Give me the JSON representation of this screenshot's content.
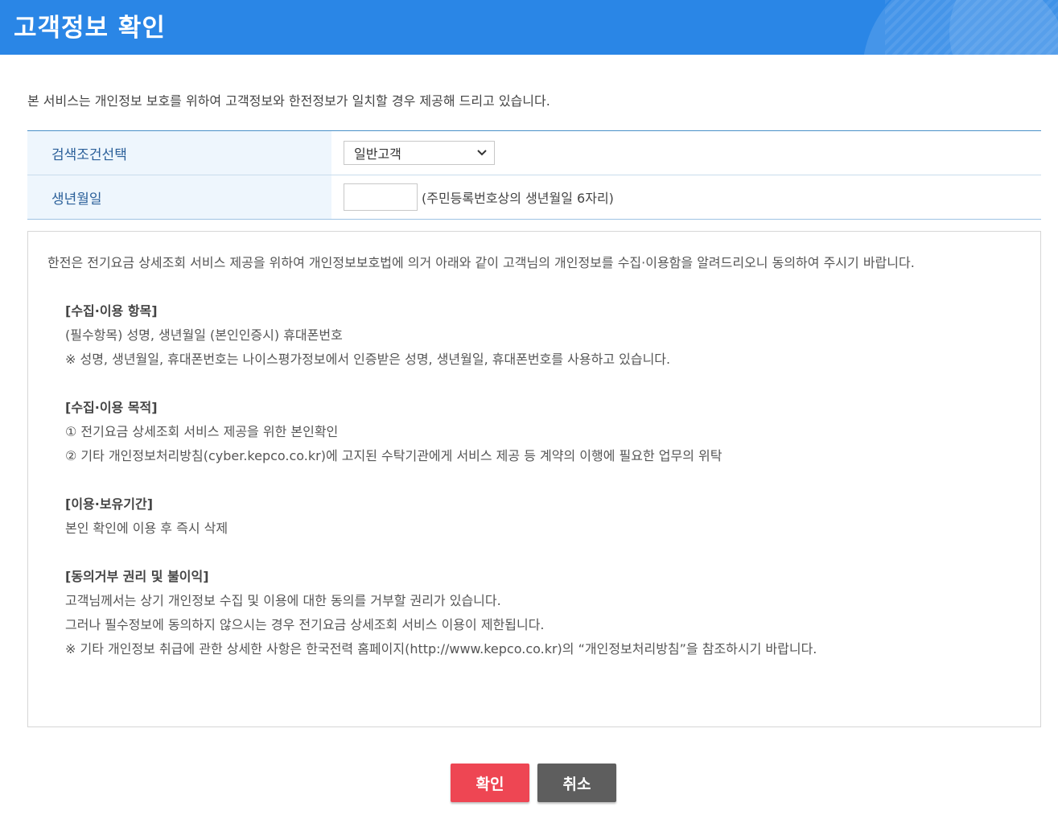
{
  "header": {
    "title": "고객정보 확인"
  },
  "intro": "본 서비스는 개인정보 보호를 위하여 고객정보와 한전정보가 일치할 경우 제공해 드리고 있습니다.",
  "form": {
    "search_label": "검색조건선택",
    "search_selected": "일반고객",
    "birth_label": "생년월일",
    "birth_value": "",
    "birth_hint": "(주민등록번호상의 생년월일 6자리)"
  },
  "terms": {
    "lead": "한전은 전기요금 상세조회 서비스 제공을 위하여 개인정보보호법에 의거 아래와 같이 고객님의 개인정보를 수집·이용함을 알려드리오니 동의하여 주시기 바랍니다.",
    "sections": [
      {
        "title": "[수집·이용 항목]",
        "lines": [
          "(필수항목) 성명, 생년월일 (본인인증시) 휴대폰번호",
          "※ 성명, 생년월일, 휴대폰번호는 나이스평가정보에서 인증받은 성명, 생년월일, 휴대폰번호를 사용하고 있습니다."
        ]
      },
      {
        "title": "[수집·이용 목적]",
        "lines": [
          "① 전기요금 상세조회 서비스 제공을 위한 본인확인",
          "② 기타 개인정보처리방침(cyber.kepco.co.kr)에 고지된 수탁기관에게 서비스 제공 등 계약의 이행에 필요한 업무의 위탁"
        ]
      },
      {
        "title": "[이용·보유기간]",
        "lines": [
          "본인 확인에 이용 후 즉시 삭제"
        ]
      },
      {
        "title": "[동의거부 권리 및 불이익]",
        "lines": [
          "고객님께서는 상기 개인정보 수집 및 이용에 대한 동의를 거부할 권리가 있습니다.",
          "그러나 필수정보에 동의하지 않으시는 경우 전기요금 상세조회 서비스 이용이 제한됩니다.",
          "※ 기타 개인정보 취급에 관한 상세한 사항은 한국전력 홈페이지(http://www.kepco.co.kr)의 “개인정보처리방침”을 참조하시기 바랍니다."
        ]
      }
    ]
  },
  "buttons": {
    "confirm": "확인",
    "cancel": "취소"
  },
  "colors": {
    "header": "#2a86e6",
    "confirm": "#ee4653",
    "cancel": "#5e5e5e",
    "label_bg": "#eef6fd"
  }
}
